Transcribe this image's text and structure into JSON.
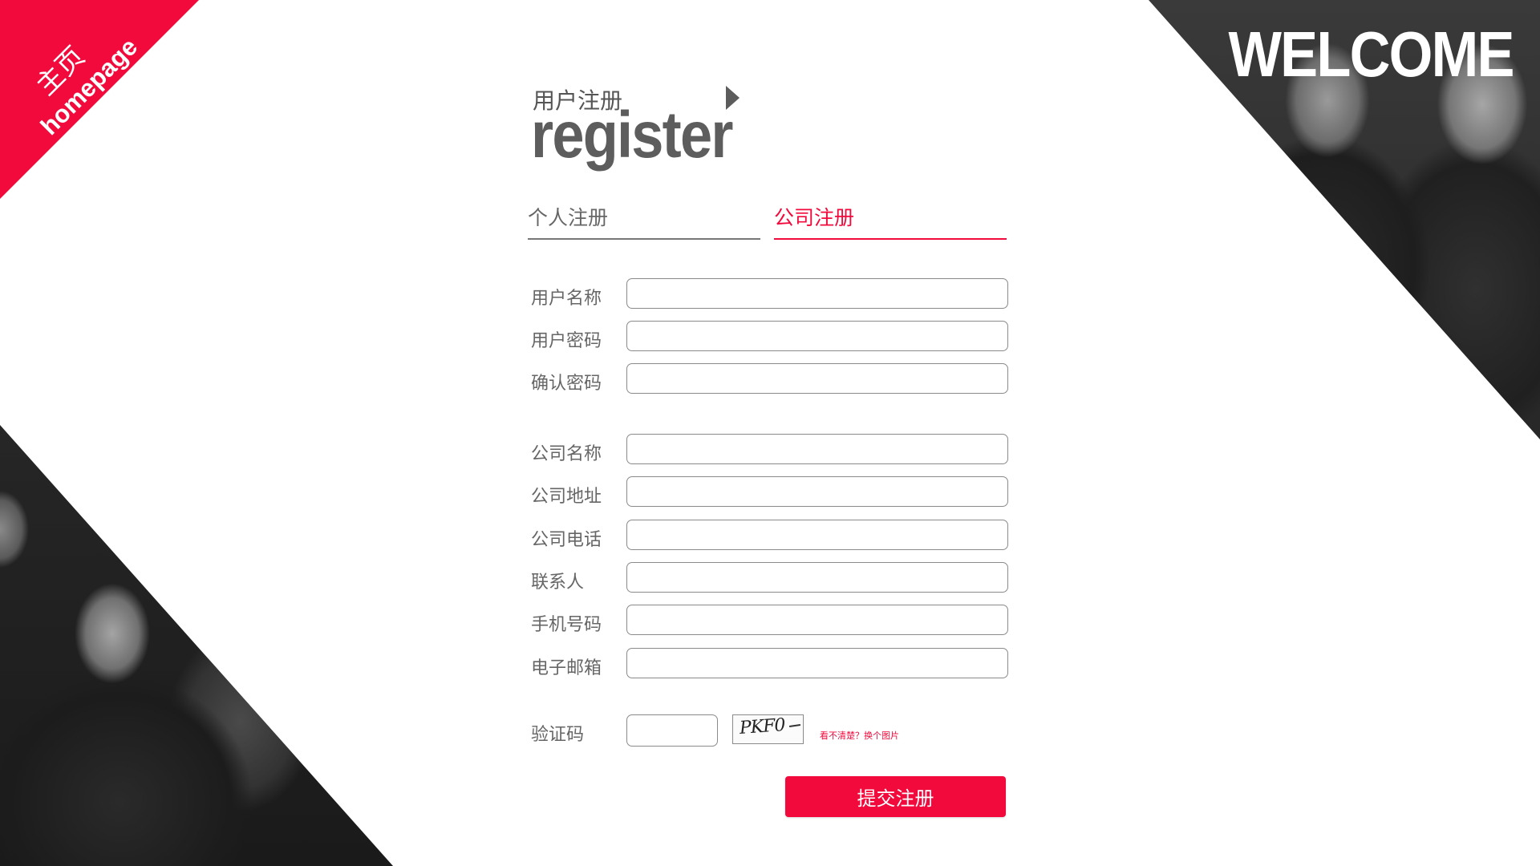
{
  "corner": {
    "title_zh": "主页",
    "title_en": "homepage",
    "color": "#f20a3c"
  },
  "welcome": "WELCOME",
  "heading": {
    "zh": "用户注册",
    "en": "register",
    "arrow_icon": "triangle-right-icon"
  },
  "tabs": [
    {
      "label": "个人注册",
      "active": false
    },
    {
      "label": "公司注册",
      "active": true
    }
  ],
  "form": {
    "fields": [
      {
        "label": "用户名称",
        "value": "",
        "placeholder": ""
      },
      {
        "label": "用户密码",
        "value": "",
        "placeholder": ""
      },
      {
        "label": "确认密码",
        "value": "",
        "placeholder": ""
      },
      {
        "label": "公司名称",
        "value": "",
        "placeholder": ""
      },
      {
        "label": "公司地址",
        "value": "",
        "placeholder": ""
      },
      {
        "label": "公司电话",
        "value": "",
        "placeholder": ""
      },
      {
        "label": "联系人",
        "value": "",
        "placeholder": ""
      },
      {
        "label": "手机号码",
        "value": "",
        "placeholder": ""
      },
      {
        "label": "电子邮箱",
        "value": "",
        "placeholder": ""
      }
    ],
    "captcha": {
      "label": "验证码",
      "value": "",
      "image_text": "PKF0",
      "refresh_text": "看不清楚？换个图片"
    },
    "submit_label": "提交注册"
  },
  "colors": {
    "accent": "#f20a3c",
    "text": "#666666",
    "dark_panel": "#2a2a2a"
  }
}
